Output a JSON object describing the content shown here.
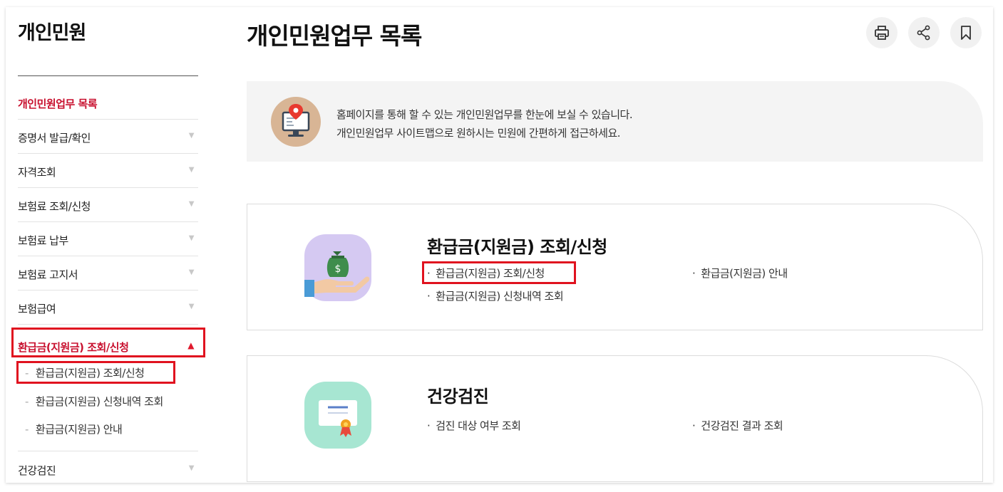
{
  "sidebar": {
    "title": "개인민원",
    "items": [
      {
        "label": "개인민원업무 목록"
      },
      {
        "label": "증명서 발급/확인",
        "arrow": "▼"
      },
      {
        "label": "자격조회",
        "arrow": "▼"
      },
      {
        "label": "보험료 조회/신청",
        "arrow": "▼"
      },
      {
        "label": "보험료 납부",
        "arrow": "▼"
      },
      {
        "label": "보험료 고지서",
        "arrow": "▼"
      },
      {
        "label": "보험급여",
        "arrow": "▼"
      },
      {
        "label": "환급금(지원금) 조회/신청",
        "arrow": "▲"
      },
      {
        "label": "건강검진",
        "arrow": "▼"
      }
    ],
    "sub_items": [
      {
        "dash": "-",
        "label": "환급금(지원금) 조회/신청"
      },
      {
        "dash": "-",
        "label": "환급금(지원금) 신청내역 조회"
      },
      {
        "dash": "-",
        "label": "환급금(지원금) 안내"
      }
    ]
  },
  "main": {
    "title": "개인민원업무 목록",
    "tools": [
      {
        "icon": "printer-icon"
      },
      {
        "icon": "share-icon"
      },
      {
        "icon": "bookmark-icon"
      }
    ],
    "info": {
      "line1": "홈페이지를 통해 할 수 있는 개인민원업무를 한눈에 보실 수 있습니다.",
      "line2": "개인민원업무 사이트맵으로 원하시는 민원에 간편하게 접근하세요."
    },
    "cards": [
      {
        "title": "환급금(지원금) 조회/신청",
        "icon": "money-bag-icon",
        "links": [
          "환급금(지원금) 조회/신청",
          "환급금(지원금) 안내",
          "환급금(지원금) 신청내역 조회"
        ]
      },
      {
        "title": "건강검진",
        "icon": "certificate-icon",
        "links": [
          "검진 대상 여부 조회",
          "건강검진 결과 조회"
        ]
      }
    ],
    "bullet": "·"
  },
  "colors": {
    "accent_red": "#c8102e",
    "highlight_box": "#e0121f",
    "card1_icon_bg": "#d5c9f2",
    "card2_icon_bg": "#a7e6d2",
    "info_icon_bg": "#d8b595"
  }
}
